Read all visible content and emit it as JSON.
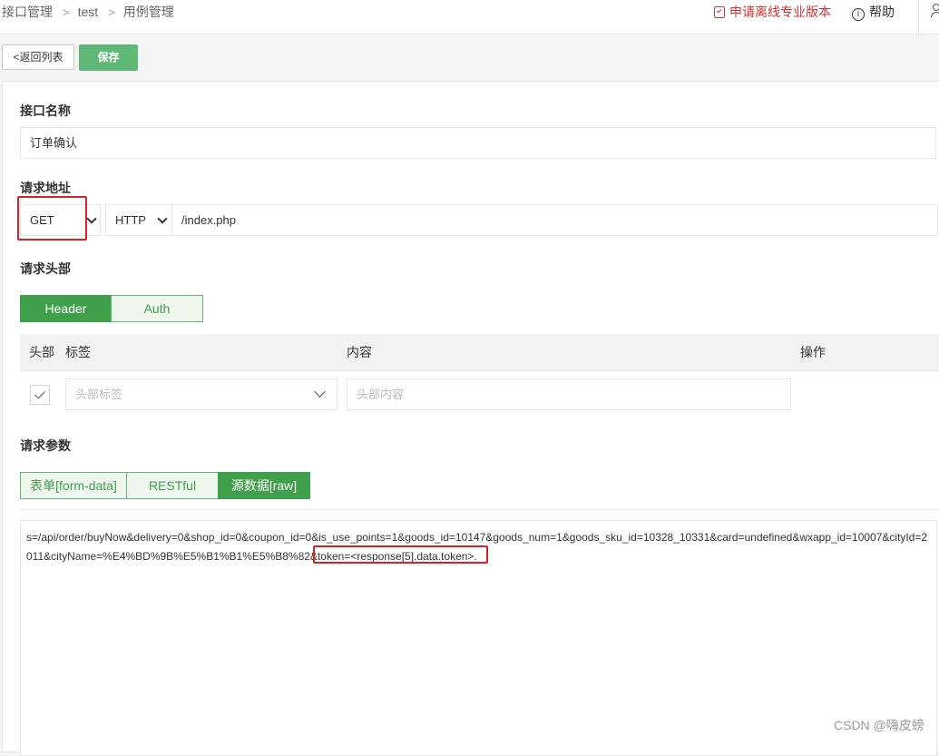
{
  "breadcrumb": {
    "items": [
      "接口管理",
      "test",
      "用例管理"
    ],
    "separator": ">"
  },
  "header": {
    "pro_link": "申请离线专业版本",
    "help": "帮助",
    "help_glyph": "i"
  },
  "toolbar": {
    "back_label": "返回列表",
    "back_glyph": "<",
    "save_label": "保存"
  },
  "form": {
    "name_label": "接口名称",
    "name_value": "订单确认",
    "url_label": "请求地址",
    "method": "GET",
    "protocol": "HTTP",
    "path": "/index.php",
    "headers_label": "请求头部",
    "header_tabs": [
      {
        "label": "Header",
        "active": true
      },
      {
        "label": "Auth",
        "active": false
      }
    ],
    "header_table": {
      "columns": [
        "头部",
        "标签",
        "内容",
        "操作"
      ],
      "row": {
        "checked": true,
        "key_placeholder": "头部标签",
        "value_placeholder": "头部内容"
      }
    },
    "params_label": "请求参数",
    "param_tabs": [
      {
        "label": "表单[form-data]",
        "active": false
      },
      {
        "label": "RESTful",
        "active": false
      },
      {
        "label": "源数据[raw]",
        "active": true
      }
    ],
    "raw_body_prefix": "s=/api/order/buyNow&delivery=0&shop_id=0&coupon_id=0&is_use_points=1&goods_id=10147&goods_num=1&goods_sku_id=10328_10331&card=undefined&wxapp_id=10007&cityId=2011&cityName=%E4%BD%9B%E5%B1%B1%E5%B8%82&",
    "raw_body_token": "token=<response[5].data.token>."
  },
  "watermark": "CSDN @嗨皮螃",
  "colors": {
    "accent_green": "#3f9f4b",
    "save_green": "#5fb878",
    "pro_red": "#d9302c",
    "highlight_red": "#e02020"
  },
  "icons": [
    "chevron-right-icon",
    "checklist-icon",
    "info-icon",
    "user-icon",
    "chevron-left-icon",
    "chevron-down-icon",
    "check-icon"
  ]
}
